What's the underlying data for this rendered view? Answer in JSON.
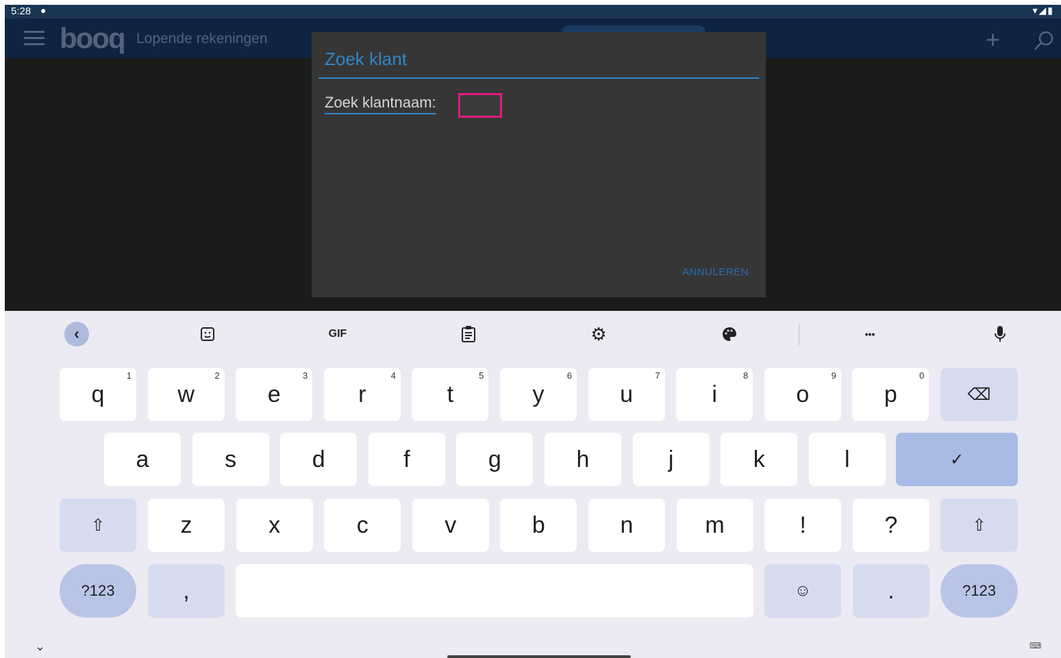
{
  "status_bar": {
    "time": "5:28",
    "notification_icon": "sync-icon",
    "right_icons": "▾◢▮"
  },
  "app_bar": {
    "logo": "booq",
    "title": "Lopende rekeningen",
    "add_icon": "add-icon",
    "search_icon": "search-icon"
  },
  "dialog": {
    "title": "Zoek klant",
    "field_label": "Zoek klantnaam:",
    "field_value": "",
    "cancel_label": "ANNULEREN"
  },
  "keyboard": {
    "toolbar": {
      "back": "‹",
      "sticker": "☺",
      "gif": "GIF",
      "clipboard": "📋",
      "settings": "⚙",
      "theme": "🎨",
      "more": "•••",
      "mic": "🎤"
    },
    "row1": [
      {
        "label": "q",
        "hint": "1"
      },
      {
        "label": "w",
        "hint": "2"
      },
      {
        "label": "e",
        "hint": "3"
      },
      {
        "label": "r",
        "hint": "4"
      },
      {
        "label": "t",
        "hint": "5"
      },
      {
        "label": "y",
        "hint": "6"
      },
      {
        "label": "u",
        "hint": "7"
      },
      {
        "label": "i",
        "hint": "8"
      },
      {
        "label": "o",
        "hint": "9"
      },
      {
        "label": "p",
        "hint": "0"
      }
    ],
    "row2": [
      "a",
      "s",
      "d",
      "f",
      "g",
      "h",
      "j",
      "k",
      "l"
    ],
    "row3": [
      "z",
      "x",
      "c",
      "v",
      "b",
      "n",
      "m",
      "!",
      "?"
    ],
    "backspace": "⌫",
    "enter": "✓",
    "shift": "⇧",
    "symbols": "?123",
    "comma": ",",
    "emoji": "☺",
    "period": ".",
    "collapse": "⌄",
    "switch": "⌨"
  }
}
